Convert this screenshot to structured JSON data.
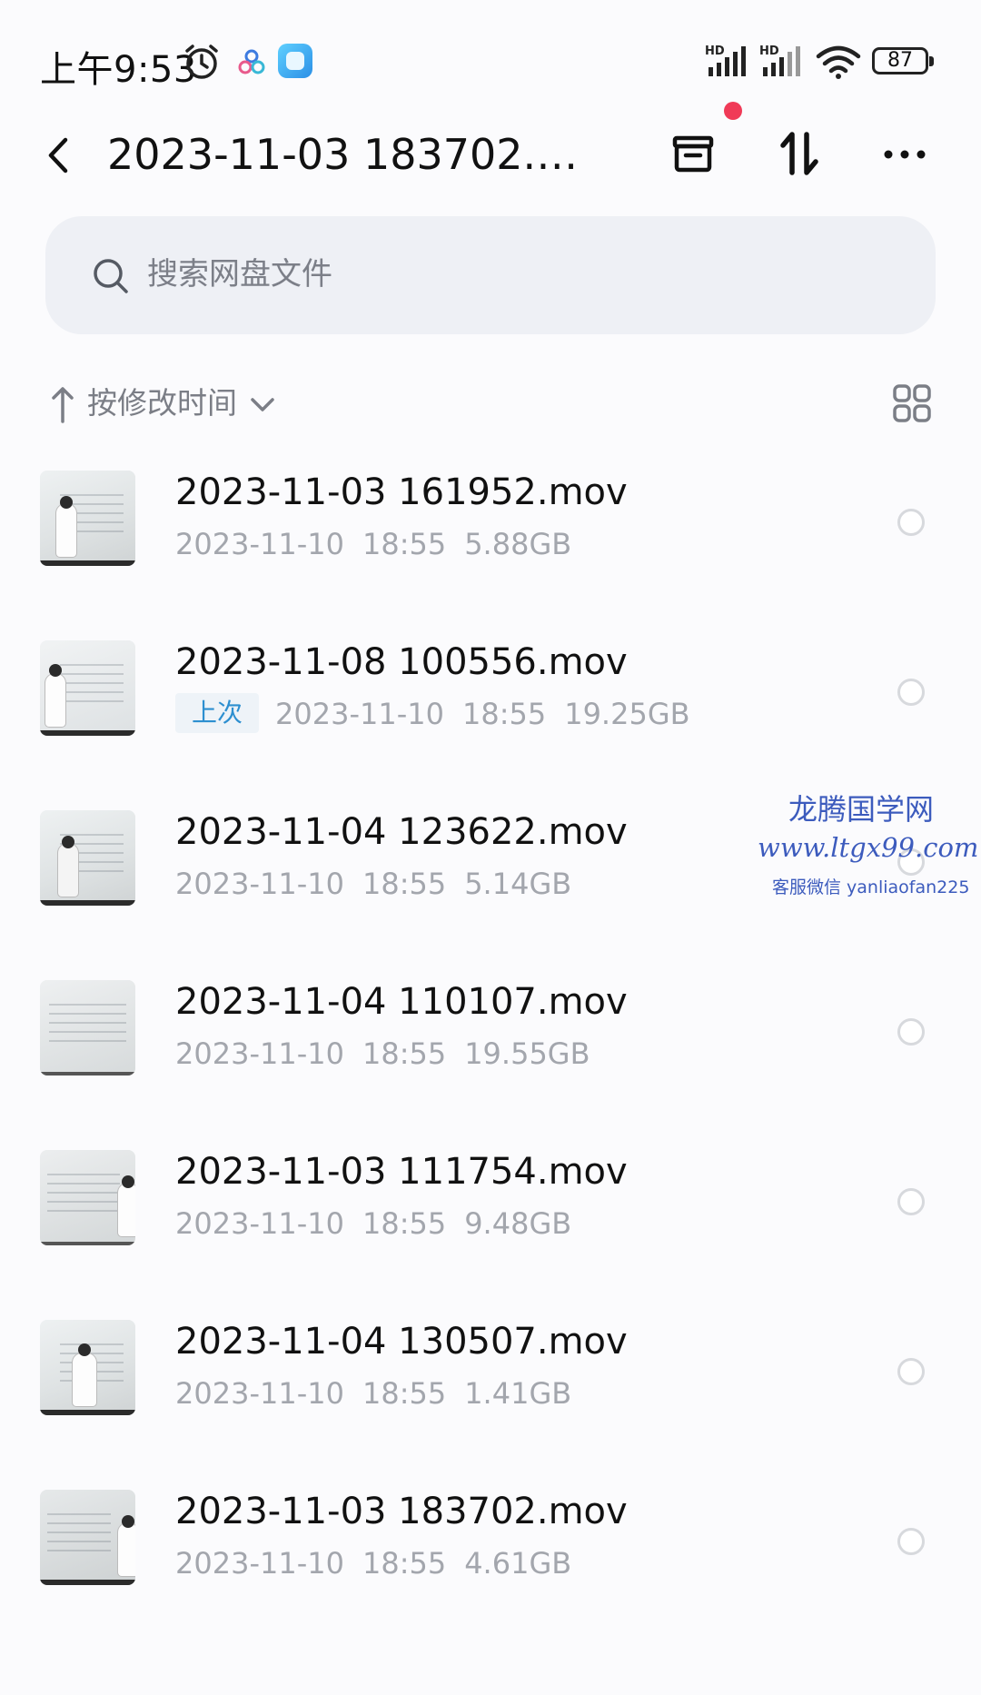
{
  "status_bar": {
    "time": "上午9:53",
    "signal1_label": "HD",
    "signal2_label": "HD",
    "battery": "87"
  },
  "header": {
    "title": "2023-11-03 183702.mo...",
    "icons": [
      "back-icon",
      "archive-icon",
      "transfer-icon",
      "more-icon"
    ]
  },
  "search": {
    "placeholder": "搜索网盘文件"
  },
  "sort": {
    "label": "按修改时间"
  },
  "files": [
    {
      "name": "2023-11-03 161952.mov",
      "date": "2023-11-10",
      "time": "18:55",
      "size": "5.88GB",
      "badge": ""
    },
    {
      "name": "2023-11-08 100556.mov",
      "date": "2023-11-10",
      "time": "18:55",
      "size": "19.25GB",
      "badge": "上次"
    },
    {
      "name": "2023-11-04 123622.mov",
      "date": "2023-11-10",
      "time": "18:55",
      "size": "5.14GB",
      "badge": ""
    },
    {
      "name": "2023-11-04 110107.mov",
      "date": "2023-11-10",
      "time": "18:55",
      "size": "19.55GB",
      "badge": ""
    },
    {
      "name": "2023-11-03 111754.mov",
      "date": "2023-11-10",
      "time": "18:55",
      "size": "9.48GB",
      "badge": ""
    },
    {
      "name": "2023-11-04 130507.mov",
      "date": "2023-11-10",
      "time": "18:55",
      "size": "1.41GB",
      "badge": ""
    },
    {
      "name": "2023-11-03 183702.mov",
      "date": "2023-11-10",
      "time": "18:55",
      "size": "4.61GB",
      "badge": ""
    }
  ],
  "watermark": {
    "line1": "龙腾国学网",
    "line2": "www.ltgx99.com",
    "line3": "客服微信 yanliaofan225"
  },
  "colors": {
    "accent": "#2d8fd0",
    "notification_dot": "#f03a57",
    "watermark": "#3c5bbd"
  }
}
